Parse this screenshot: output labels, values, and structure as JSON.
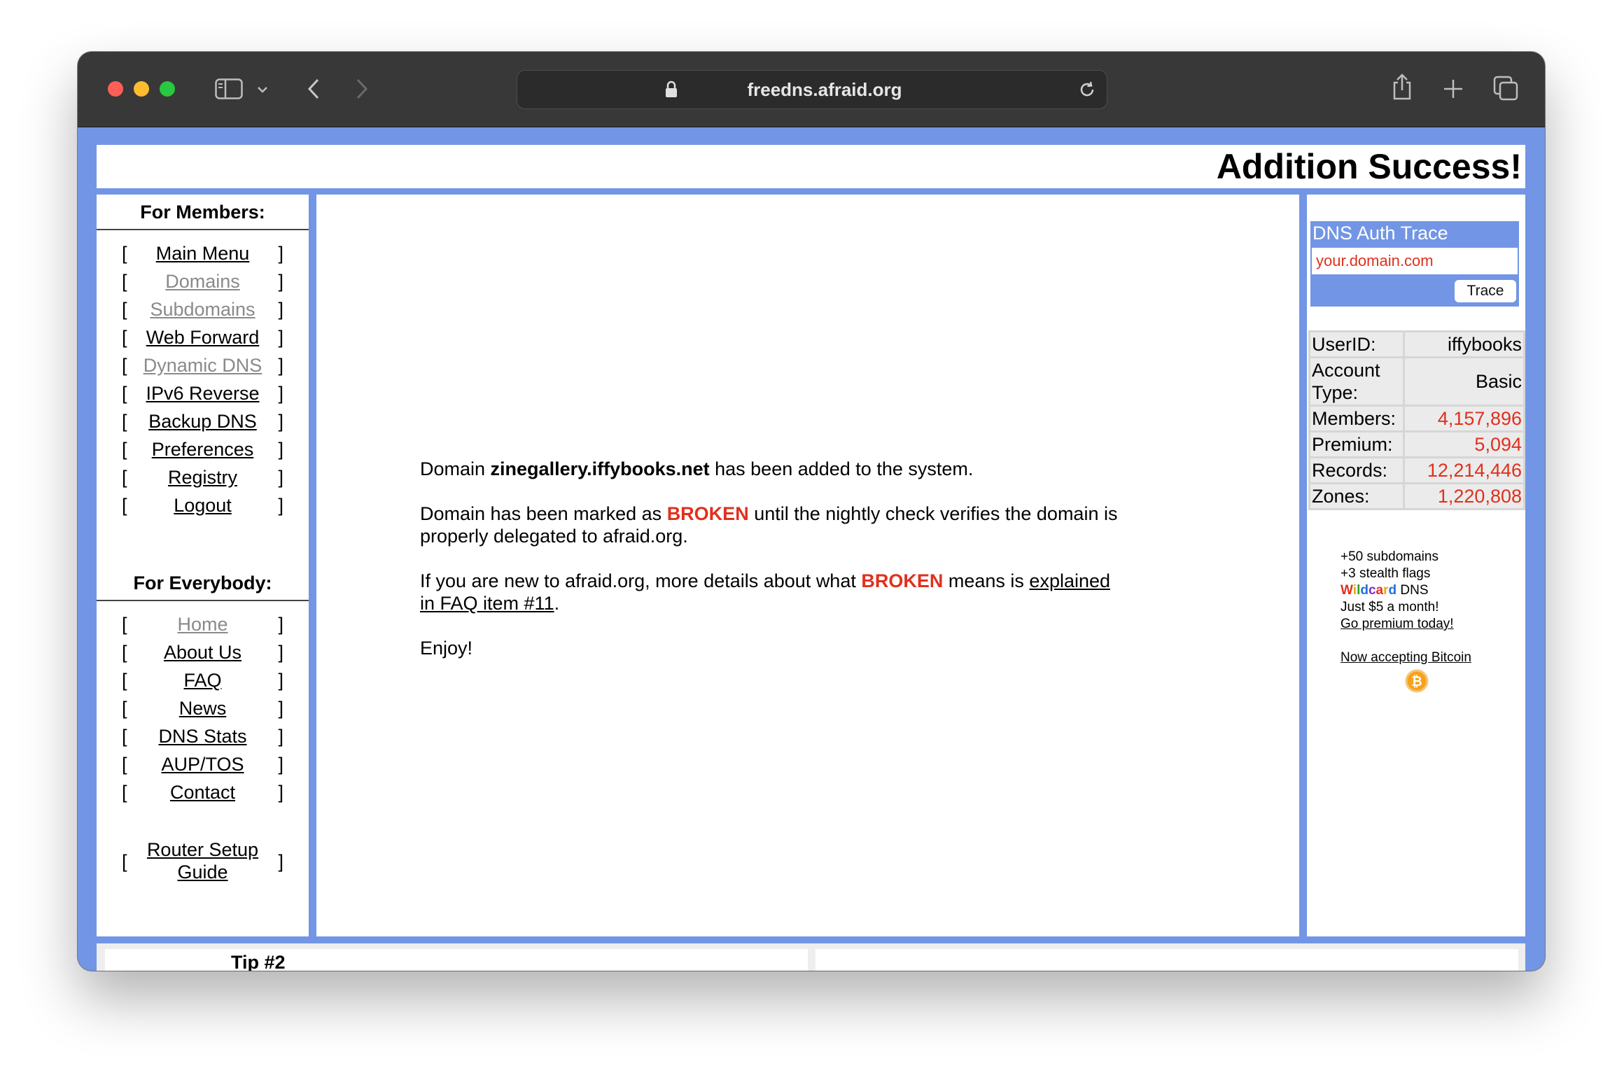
{
  "browser": {
    "url": "freedns.afraid.org",
    "controls": [
      "close",
      "minimize",
      "zoom"
    ],
    "icons": [
      "sidebar-icon",
      "chevron-down-icon",
      "back-icon",
      "forward-icon",
      "lock-icon",
      "reload-icon",
      "share-icon",
      "new-tab-icon",
      "tabs-overview-icon"
    ]
  },
  "header": {
    "title": "Addition Success!"
  },
  "sidebar": {
    "members_heading": "For Members:",
    "members_links": [
      {
        "label": "Main Menu",
        "dim": false
      },
      {
        "label": "Domains",
        "dim": true
      },
      {
        "label": "Subdomains",
        "dim": true
      },
      {
        "label": "Web Forward",
        "dim": false
      },
      {
        "label": "Dynamic DNS",
        "dim": true
      },
      {
        "label": "IPv6 Reverse",
        "dim": false
      },
      {
        "label": "Backup DNS",
        "dim": false
      },
      {
        "label": "Preferences",
        "dim": false
      },
      {
        "label": "Registry",
        "dim": false
      },
      {
        "label": "Logout",
        "dim": false
      }
    ],
    "everybody_heading": "For Everybody:",
    "everybody_links": [
      {
        "label": "Home",
        "dim": true
      },
      {
        "label": "About Us",
        "dim": false
      },
      {
        "label": "FAQ",
        "dim": false
      },
      {
        "label": "News",
        "dim": false
      },
      {
        "label": "DNS Stats",
        "dim": false
      },
      {
        "label": "AUP/TOS",
        "dim": false
      },
      {
        "label": "Contact",
        "dim": false
      }
    ],
    "router_link": {
      "line1": "Router Setup",
      "line2": "Guide"
    },
    "bracket_open": "[",
    "bracket_close": "]"
  },
  "main": {
    "p1_prefix": "Domain ",
    "p1_domain": "zinegallery.iffybooks.net",
    "p1_suffix": " has been added to the system.",
    "p2_prefix": "Domain has been marked as ",
    "p2_broken": "BROKEN",
    "p2_suffix_line1": " until the nightly check verifies the domain is",
    "p2_line2": "properly delegated to afraid.org.",
    "p3_prefix": "If you are new to afraid.org, more details about what ",
    "p3_broken": "BROKEN",
    "p3_mid": " means is ",
    "p3_link1": "explained",
    "p3_link2": "in FAQ item #11",
    "p3_end": ".",
    "p4": "Enjoy!"
  },
  "right": {
    "trace_title": "DNS Auth Trace",
    "trace_placeholder": "your.domain.com",
    "trace_button": "Trace",
    "stats": [
      {
        "label": "UserID:",
        "value": "iffybooks",
        "red": false
      },
      {
        "label": "Account Type:",
        "value": "Basic",
        "red": false
      },
      {
        "label": "Members:",
        "value": "4,157,896",
        "red": true
      },
      {
        "label": "Premium:",
        "value": "5,094",
        "red": true
      },
      {
        "label": "Records:",
        "value": "12,214,446",
        "red": true
      },
      {
        "label": "Zones:",
        "value": "1,220,808",
        "red": true
      }
    ],
    "promo": {
      "line1": "+50 subdomains",
      "line2": "+3 stealth flags",
      "wildcard": "Wildcard",
      "dns": " DNS",
      "line4": "Just $5 a month!",
      "premium_link": "Go premium today!",
      "bitcoin_link": "Now accepting Bitcoin"
    }
  },
  "bottom": {
    "tip_title": "Tip #2"
  },
  "colors": {
    "frame_blue": "#7296e5",
    "broken_red": "#e0301e",
    "titlebar": "#383838"
  }
}
